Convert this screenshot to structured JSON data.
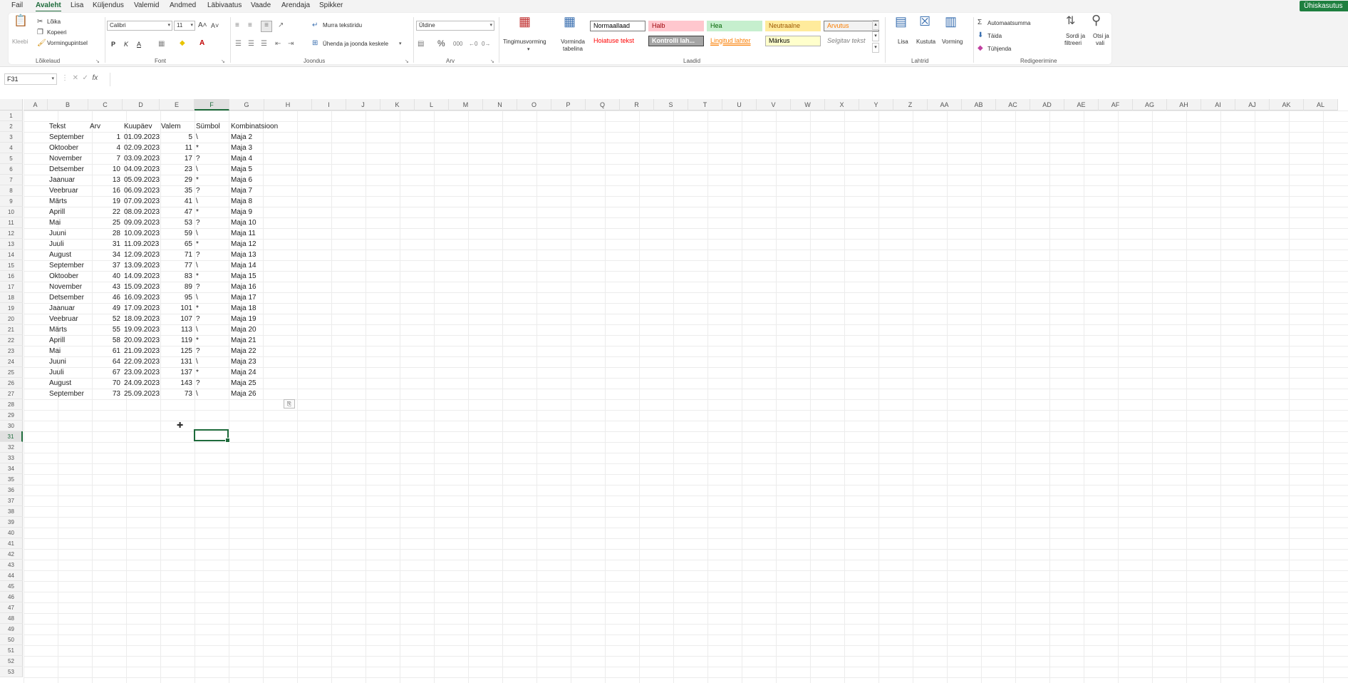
{
  "menu": {
    "tabs": [
      "Fail",
      "Avaleht",
      "Lisa",
      "Küljendus",
      "Valemid",
      "Andmed",
      "Läbivaatus",
      "Vaade",
      "Arendaja",
      "Spikker"
    ],
    "active_tab": "Avaleht",
    "share_label": "Ühiskasutus"
  },
  "ribbon": {
    "clipboard": {
      "paste_label": "Kleebi",
      "cut_label": "Lõika",
      "copy_label": "Kopeeri",
      "format_painter_label": "Vormingupintsel",
      "group_label": "Lõikelaud"
    },
    "font": {
      "font_name": "Calibri",
      "font_size": "11",
      "bold": "P",
      "italic": "K",
      "underline": "A",
      "group_label": "Font"
    },
    "alignment": {
      "wrap_label": "Murra tekstiridu",
      "merge_label": "Ühenda ja joonda keskele",
      "group_label": "Joondus"
    },
    "number": {
      "format_value": "Üldine",
      "group_label": "Arv"
    },
    "styles": {
      "conditional_label": "Tingimusvorming",
      "table_label": "Vorminda tabelina",
      "cells": [
        {
          "label": "Normaallaad",
          "bg": "#ffffff",
          "fg": "#000000",
          "border": "#7a7a7a"
        },
        {
          "label": "Halb",
          "bg": "#ffc7ce",
          "fg": "#9c0006"
        },
        {
          "label": "Hea",
          "bg": "#c6efce",
          "fg": "#006100"
        },
        {
          "label": "Neutraalne",
          "bg": "#ffeb9c",
          "fg": "#9c5700"
        },
        {
          "label": "Arvutus",
          "bg": "#f2f2f2",
          "fg": "#fa7d00",
          "border": "#7f7f7f"
        },
        {
          "label": "Hoiatuse tekst",
          "bg": "#ffffff",
          "fg": "#ff0000"
        },
        {
          "label": "Kontrolli lah...",
          "bg": "#a5a5a5",
          "fg": "#ffffff",
          "border": "#3f3f3f"
        },
        {
          "label": "Lingitud lahter",
          "bg": "#ffffff",
          "fg": "#fa7d00"
        },
        {
          "label": "Märkus",
          "bg": "#ffffcc",
          "fg": "#000000",
          "border": "#b2b2b2"
        },
        {
          "label": "Selgitav tekst",
          "bg": "#ffffff",
          "fg": "#7f7f7f"
        }
      ],
      "group_label": "Laadid"
    },
    "cells_group": {
      "insert_label": "Lisa",
      "delete_label": "Kustuta",
      "format_label": "Vorming",
      "group_label": "Lahtrid"
    },
    "editing": {
      "autosum_label": "Automaatsumma",
      "fill_label": "Täida",
      "clear_label": "Tühjenda",
      "sort_label_1": "Sordi ja",
      "sort_label_2": "filtreeri",
      "find_label_1": "Otsi ja",
      "find_label_2": "vali",
      "group_label": "Redigeerimine"
    }
  },
  "formula_bar": {
    "name_box": "F31",
    "fx": "fx"
  },
  "columns": [
    "A",
    "B",
    "C",
    "D",
    "E",
    "F",
    "G",
    "H",
    "I",
    "J",
    "K",
    "L",
    "M",
    "N",
    "O",
    "P",
    "Q",
    "R",
    "S",
    "T",
    "U",
    "V",
    "W",
    "X",
    "Y",
    "Z",
    "AA",
    "AB",
    "AC",
    "AD",
    "AE",
    "AF",
    "AG",
    "AH",
    "AI",
    "AJ",
    "AK",
    "AL"
  ],
  "selected_column": "F",
  "selected_row": "31",
  "headers": {
    "B": "Tekst",
    "C": "Arv",
    "D": "Kuupäev",
    "E": "Valem",
    "F": "Sümbol",
    "G": "Kombinatsioon"
  },
  "rows": [
    [
      "September",
      "1",
      "01.09.2023",
      "5",
      "\\",
      "Maja 2"
    ],
    [
      "Oktoober",
      "4",
      "02.09.2023",
      "11",
      "*",
      "Maja 3"
    ],
    [
      "November",
      "7",
      "03.09.2023",
      "17",
      "?",
      "Maja 4"
    ],
    [
      "Detsember",
      "10",
      "04.09.2023",
      "23",
      "\\",
      "Maja 5"
    ],
    [
      "Jaanuar",
      "13",
      "05.09.2023",
      "29",
      "*",
      "Maja 6"
    ],
    [
      "Veebruar",
      "16",
      "06.09.2023",
      "35",
      "?",
      "Maja 7"
    ],
    [
      "Märts",
      "19",
      "07.09.2023",
      "41",
      "\\",
      "Maja 8"
    ],
    [
      "Aprill",
      "22",
      "08.09.2023",
      "47",
      "*",
      "Maja 9"
    ],
    [
      "Mai",
      "25",
      "09.09.2023",
      "53",
      "?",
      "Maja 10"
    ],
    [
      "Juuni",
      "28",
      "10.09.2023",
      "59",
      "\\",
      "Maja 11"
    ],
    [
      "Juuli",
      "31",
      "11.09.2023",
      "65",
      "*",
      "Maja 12"
    ],
    [
      "August",
      "34",
      "12.09.2023",
      "71",
      "?",
      "Maja 13"
    ],
    [
      "September",
      "37",
      "13.09.2023",
      "77",
      "\\",
      "Maja 14"
    ],
    [
      "Oktoober",
      "40",
      "14.09.2023",
      "83",
      "*",
      "Maja 15"
    ],
    [
      "November",
      "43",
      "15.09.2023",
      "89",
      "?",
      "Maja 16"
    ],
    [
      "Detsember",
      "46",
      "16.09.2023",
      "95",
      "\\",
      "Maja 17"
    ],
    [
      "Jaanuar",
      "49",
      "17.09.2023",
      "101",
      "*",
      "Maja 18"
    ],
    [
      "Veebruar",
      "52",
      "18.09.2023",
      "107",
      "?",
      "Maja 19"
    ],
    [
      "Märts",
      "55",
      "19.09.2023",
      "113",
      "\\",
      "Maja 20"
    ],
    [
      "Aprill",
      "58",
      "20.09.2023",
      "119",
      "*",
      "Maja 21"
    ],
    [
      "Mai",
      "61",
      "21.09.2023",
      "125",
      "?",
      "Maja 22"
    ],
    [
      "Juuni",
      "64",
      "22.09.2023",
      "131",
      "\\",
      "Maja 23"
    ],
    [
      "Juuli",
      "67",
      "23.09.2023",
      "137",
      "*",
      "Maja 24"
    ],
    [
      "August",
      "70",
      "24.09.2023",
      "143",
      "?",
      "Maja 25"
    ],
    [
      "September",
      "73",
      "25.09.2023",
      "73",
      "\\",
      "Maja 26"
    ]
  ],
  "row_numbers": [
    "1",
    "2",
    "3",
    "4",
    "5",
    "6",
    "7",
    "8",
    "9",
    "10",
    "11",
    "12",
    "13",
    "14",
    "15",
    "16",
    "17",
    "18",
    "19",
    "20",
    "21",
    "22",
    "23",
    "24",
    "25",
    "26",
    "27",
    "28",
    "29",
    "30",
    "31",
    "32",
    "33",
    "34",
    "35",
    "36",
    "37",
    "38",
    "39",
    "40",
    "41",
    "42",
    "43",
    "44",
    "45",
    "46",
    "47",
    "48",
    "49",
    "50",
    "51",
    "52",
    "53"
  ],
  "accent_color": "#1e6b3b"
}
